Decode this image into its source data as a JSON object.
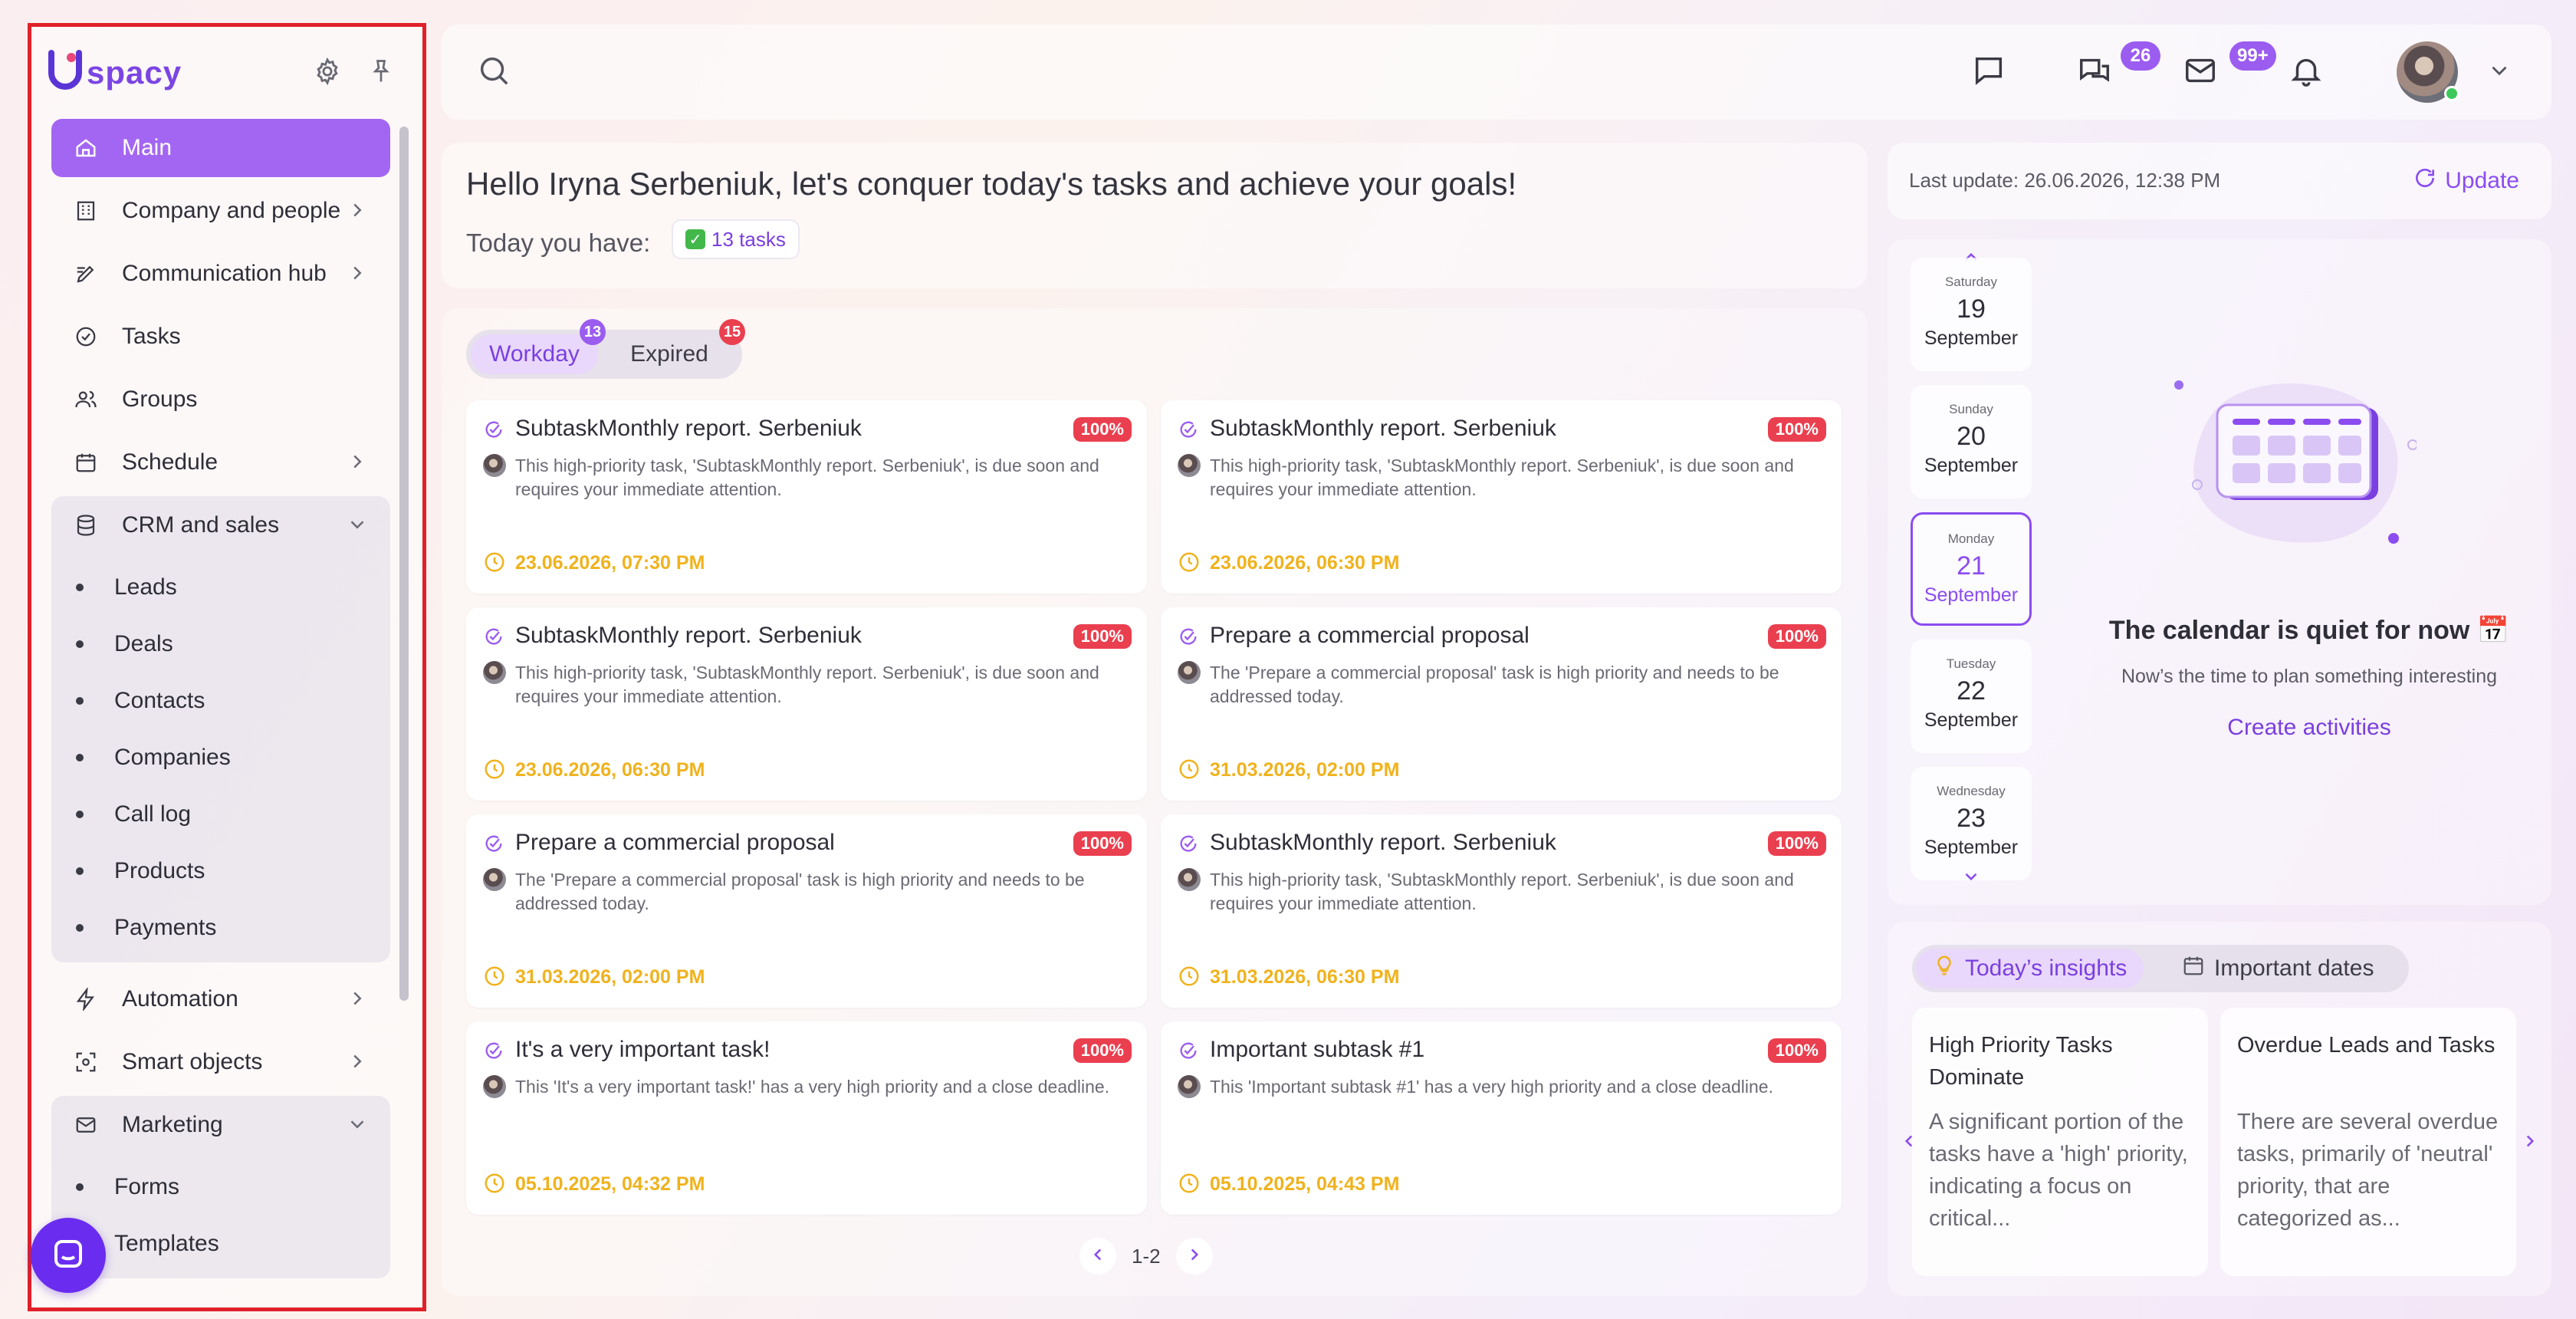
{
  "sidebar": {
    "logo_text": "spacy",
    "items": [
      {
        "label": "Main"
      },
      {
        "label": "Company and people"
      },
      {
        "label": "Communication hub"
      },
      {
        "label": "Tasks"
      },
      {
        "label": "Groups"
      },
      {
        "label": "Schedule"
      },
      {
        "label": "CRM and sales"
      },
      {
        "label": "Automation"
      },
      {
        "label": "Smart objects"
      },
      {
        "label": "Marketing"
      }
    ],
    "crm_sub": [
      "Leads",
      "Deals",
      "Contacts",
      "Companies",
      "Call log",
      "Products",
      "Payments"
    ],
    "marketing_sub": [
      "Forms",
      "Templates"
    ]
  },
  "topbar": {
    "chat_badge": "26",
    "mail_badge": "99+"
  },
  "greeting": {
    "title": "Hello Iryna Serbeniuk, let's conquer today's tasks and achieve your goals!",
    "today_label": "Today you have:",
    "tasks_count": "13 tasks"
  },
  "tasks": {
    "tabs": [
      {
        "label": "Workday",
        "badge": "13"
      },
      {
        "label": "Expired",
        "badge": "15"
      }
    ],
    "cards": [
      {
        "title": "SubtaskMonthly report. Serbeniuk",
        "percent": "100%",
        "desc": "This high-priority task, 'SubtaskMonthly report. Serbeniuk', is due soon and requires your immediate attention.",
        "date": "23.06.2026, 07:30 PM"
      },
      {
        "title": "SubtaskMonthly report. Serbeniuk",
        "percent": "100%",
        "desc": "This high-priority task, 'SubtaskMonthly report. Serbeniuk', is due soon and requires your immediate attention.",
        "date": "23.06.2026, 06:30 PM"
      },
      {
        "title": "SubtaskMonthly report. Serbeniuk",
        "percent": "100%",
        "desc": "This high-priority task, 'SubtaskMonthly report. Serbeniuk', is due soon and requires your immediate attention.",
        "date": "23.06.2026, 06:30 PM"
      },
      {
        "title": "Prepare a commercial proposal",
        "percent": "100%",
        "desc": "The 'Prepare a commercial proposal' task is high priority and needs to be addressed today.",
        "date": "31.03.2026, 02:00 PM"
      },
      {
        "title": "Prepare a commercial proposal",
        "percent": "100%",
        "desc": "The 'Prepare a commercial proposal' task is high priority and needs to be addressed today.",
        "date": "31.03.2026, 02:00 PM"
      },
      {
        "title": "SubtaskMonthly report. Serbeniuk",
        "percent": "100%",
        "desc": "This high-priority task, 'SubtaskMonthly report. Serbeniuk', is due soon and requires your immediate attention.",
        "date": "31.03.2026, 06:30 PM"
      },
      {
        "title": "It's a very important task!",
        "percent": "100%",
        "desc": "This 'It's a very important task!' has a very high priority and a close deadline.",
        "date": "05.10.2025, 04:32 PM"
      },
      {
        "title": "Important subtask #1",
        "percent": "100%",
        "desc": "This 'Important subtask #1' has a very high priority and a close deadline.",
        "date": "05.10.2025, 04:43 PM"
      }
    ],
    "pager": "1-2"
  },
  "update": {
    "text": "Last update: 26.06.2026, 12:38 PM",
    "button": "Update"
  },
  "calendar": {
    "days": [
      {
        "weekday": "Saturday",
        "day": "19",
        "month": "September"
      },
      {
        "weekday": "Sunday",
        "day": "20",
        "month": "September"
      },
      {
        "weekday": "Monday",
        "day": "21",
        "month": "September"
      },
      {
        "weekday": "Tuesday",
        "day": "22",
        "month": "September"
      },
      {
        "weekday": "Wednesday",
        "day": "23",
        "month": "September"
      }
    ],
    "selected_index": 2,
    "quiet_title": "The calendar is quiet for now 📅",
    "quiet_sub": "Now’s the time to plan something interesting",
    "create_link": "Create activities"
  },
  "insights": {
    "tabs": [
      "Today’s insights",
      "Important dates"
    ],
    "cards": [
      {
        "title": "High Priority Tasks Dominate",
        "body": "A significant portion of the tasks have a 'high' priority, indicating a focus on critical..."
      },
      {
        "title": "Overdue Leads and Tasks",
        "body": "There are several overdue tasks, primarily of 'neutral' priority, that are categorized as..."
      }
    ]
  },
  "colors": {
    "accent": "#8b4cf0",
    "active_nav": "#a366f2",
    "danger": "#ea3f4f",
    "date": "#f0b21c",
    "highlight_border": "#e0202a"
  }
}
